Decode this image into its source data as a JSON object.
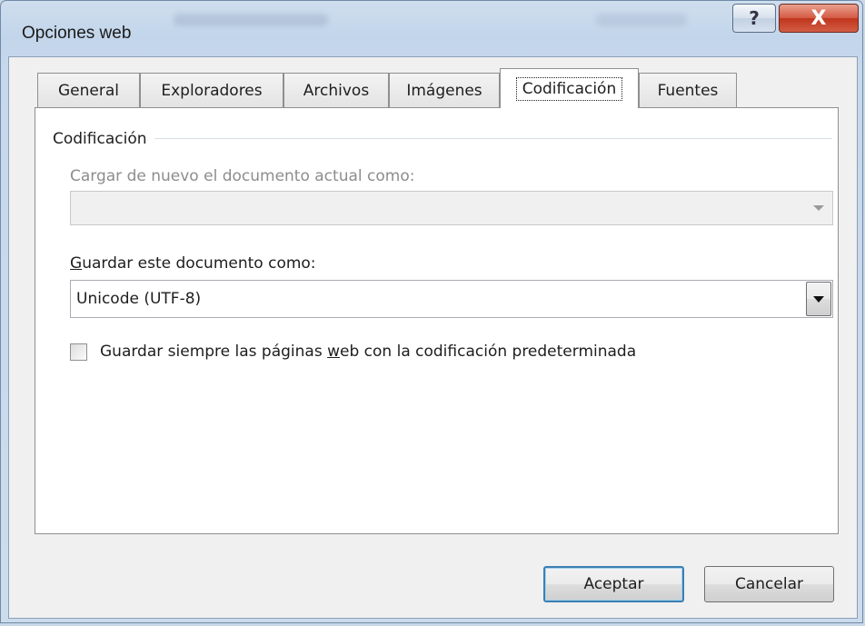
{
  "window": {
    "title": "Opciones web",
    "help_glyph": "?",
    "close_glyph": "X"
  },
  "tabs": [
    {
      "label": "General"
    },
    {
      "label": "Exploradores"
    },
    {
      "label": "Archivos"
    },
    {
      "label": "Imágenes"
    },
    {
      "label": "Codificación",
      "active": true
    },
    {
      "label": "Fuentes"
    }
  ],
  "encoding": {
    "group_title": "Codificación",
    "reload_label": "Cargar de nuevo el documento actual como:",
    "reload_value": "",
    "save_label_prefix": "G",
    "save_label_rest": "uardar este documento como:",
    "save_value": "Unicode (UTF-8)",
    "always_save_prefix": "Guardar siempre las páginas ",
    "always_save_access": "w",
    "always_save_suffix": "eb con la codificación predeterminada",
    "always_save_checked": false
  },
  "buttons": {
    "ok": "Aceptar",
    "cancel": "Cancelar"
  },
  "colors": {
    "default_button_border": "#3c7fb1",
    "close_button": "#c0351d"
  }
}
